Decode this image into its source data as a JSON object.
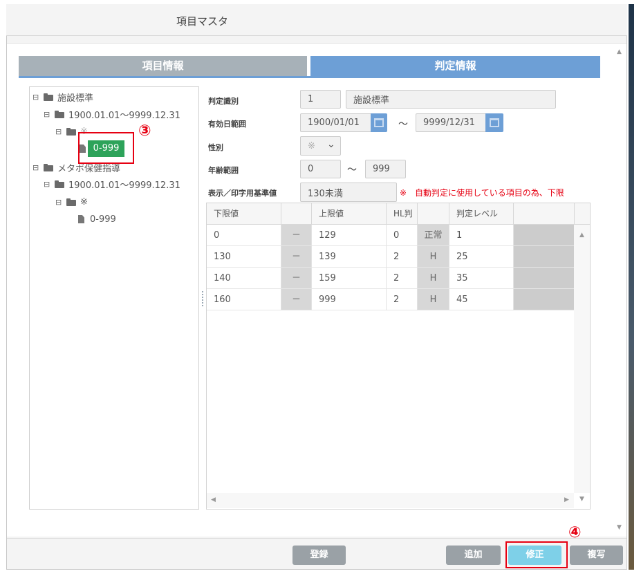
{
  "window": {
    "title": "項目マスタ"
  },
  "tabs": [
    {
      "label": "項目情報",
      "active": false
    },
    {
      "label": "判定情報",
      "active": true
    }
  ],
  "tree": {
    "nodes": [
      {
        "label": "施設標準"
      },
      {
        "label": "1900.01.01～9999.12.31"
      },
      {
        "label": "※"
      },
      {
        "label": "0-999",
        "selected": true
      },
      {
        "label": "メタボ保健指導"
      },
      {
        "label": "1900.01.01～9999.12.31"
      },
      {
        "label": "※"
      },
      {
        "label": "0-999"
      }
    ]
  },
  "annotations": {
    "step3": "③",
    "step4": "④",
    "color": "#e60012"
  },
  "form": {
    "judge_id": {
      "label": "判定識別",
      "code": "1",
      "name": "施設標準"
    },
    "valid_range": {
      "label": "有効日範囲",
      "from": "1900/01/01",
      "to": "9999/12/31",
      "sep": "～"
    },
    "gender": {
      "label": "性別",
      "value": "※"
    },
    "age_range": {
      "label": "年齢範囲",
      "from": "0",
      "to": "999",
      "sep": "～"
    },
    "display_std": {
      "label": "表示／印字用基準値",
      "value": "130未満",
      "warning": "※　自動判定に使用している項目の為、下限"
    }
  },
  "grid": {
    "headers": [
      "下限値",
      "",
      "上限値",
      "HL判定",
      "",
      "判定レベル",
      ""
    ],
    "rows": [
      {
        "lower": "0",
        "dash": "－",
        "upper": "129",
        "hl": "0",
        "hl_label": "正常",
        "level": "1"
      },
      {
        "lower": "130",
        "dash": "－",
        "upper": "139",
        "hl": "2",
        "hl_label": "H",
        "level": "25"
      },
      {
        "lower": "140",
        "dash": "－",
        "upper": "159",
        "hl": "2",
        "hl_label": "H",
        "level": "35"
      },
      {
        "lower": "160",
        "dash": "－",
        "upper": "999",
        "hl": "2",
        "hl_label": "H",
        "level": "45"
      }
    ]
  },
  "buttons": {
    "register": "登録",
    "add": "追加",
    "edit": "修正",
    "copy": "複写"
  },
  "colors": {
    "tab_active": "#6d9fd6",
    "tab_inactive": "#a7b1b8",
    "selected_node": "#2da35a",
    "edit_button": "#7ed0e8",
    "button": "#9aa1a6"
  }
}
